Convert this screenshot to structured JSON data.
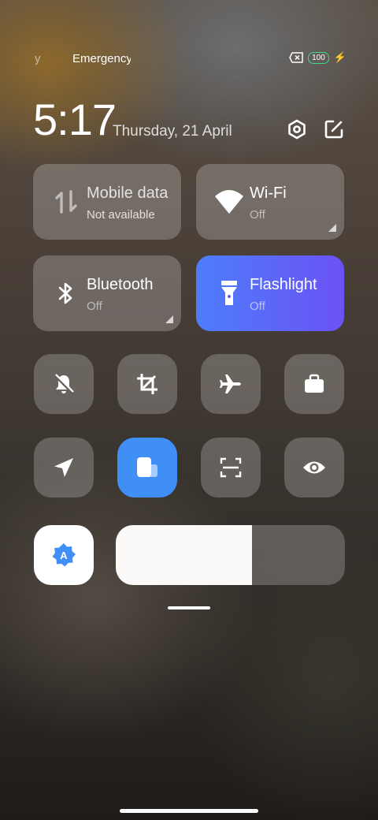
{
  "status_bar": {
    "carrier_partial": "y",
    "emergency_text": "Emergency calls only",
    "battery_level": "100",
    "icons": [
      "no-sim-icon",
      "battery-icon",
      "charging-icon"
    ]
  },
  "header": {
    "time": "5:17",
    "date": "Thursday, 21 April",
    "icons": [
      "settings-icon",
      "edit-icon"
    ]
  },
  "big_tiles": [
    {
      "title": "Mobile data",
      "subtitle": "Not available",
      "icon": "mobile-data-icon",
      "active": false,
      "has_corner": false
    },
    {
      "title": "Wi-Fi",
      "subtitle": "Off",
      "icon": "wifi-icon",
      "active": false,
      "has_corner": true
    },
    {
      "title": "Bluetooth",
      "subtitle": "Off",
      "icon": "bluetooth-icon",
      "active": false,
      "has_corner": true
    },
    {
      "title": "Flashlight",
      "subtitle": "Off",
      "icon": "flashlight-icon",
      "active": true,
      "has_corner": false
    }
  ],
  "small_tiles_row1": [
    "mute-icon",
    "crop-icon",
    "airplane-icon",
    "work-icon"
  ],
  "small_tiles_row2": [
    "location-icon",
    "floating-window-icon",
    "scan-icon",
    "reading-mode-icon"
  ],
  "brightness": {
    "auto_icon": "auto-brightness-icon",
    "auto_letter": "A",
    "level": 0.595
  },
  "colors": {
    "accent_blue": "#3f8ff6",
    "flashlight_gradient_start": "#4d7dfb",
    "flashlight_gradient_end": "#6b52f5",
    "battery_green": "#3ddc84"
  }
}
